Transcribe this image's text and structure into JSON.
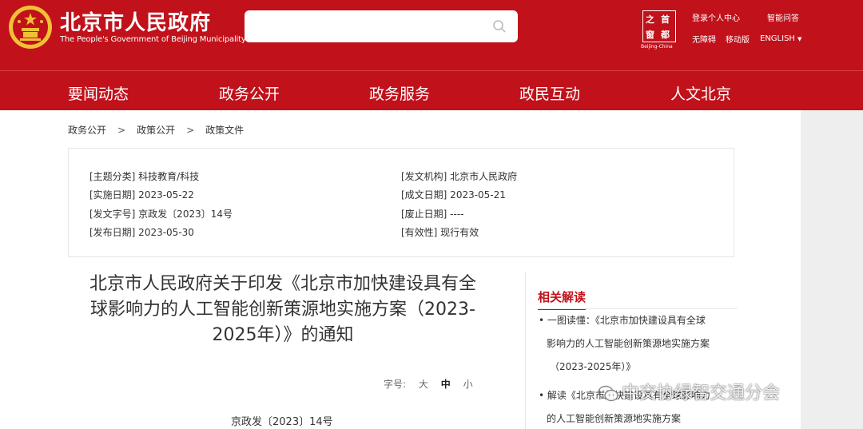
{
  "header": {
    "title": "北京市人民政府",
    "subtitle": "The People's Government of Beijing Municipality",
    "search": {
      "placeholder": ""
    },
    "capital_logo": {
      "chars": [
        "之",
        "首",
        "窗",
        "都"
      ],
      "caption": "Beijing-China"
    },
    "links": {
      "login": "登录个人中心",
      "qa": "智能问答",
      "accessible": "无障碍",
      "mobile": "移动版",
      "english": "ENGLISH"
    }
  },
  "nav": [
    "要闻动态",
    "政务公开",
    "政务服务",
    "政民互动",
    "人文北京"
  ],
  "breadcrumb": [
    "政务公开",
    "政策公开",
    "政策文件"
  ],
  "meta": {
    "topic": "[主题分类] 科技教育/科技",
    "issuer": "[发文机构] 北京市人民政府",
    "effective": "[实施日期] 2023-05-22",
    "written": "[成文日期] 2023-05-21",
    "doc_no": "[发文字号] 京政发〔2023〕14号",
    "repeal": "[废止日期] ----",
    "published": "[发布日期] 2023-05-30",
    "validity": "[有效性] 现行有效"
  },
  "article": {
    "title_lines": [
      "北京市人民政府关于印发《北京市加快建设具有全",
      "球影响力的人工智能创新策源地实施方案（2023-",
      "2025年）》的通知"
    ],
    "font_size_label": "字号:",
    "font_sizes": [
      "大",
      "中",
      "小"
    ],
    "doc_number": "京政发〔2023〕14号"
  },
  "related": {
    "heading": "相关解读",
    "items": [
      {
        "lines": [
          "• 一图读懂：《北京市加快建设具有全球",
          "影响力的人工智能创新策源地实施方案",
          "（2023-2025年）》"
        ]
      },
      {
        "lines": [
          "• 解读《北京市加快建设具有全球影响力",
          "的人工智能创新策源地实施方案"
        ]
      }
    ]
  },
  "watermark": "中交协绿智交通分会",
  "colors": {
    "brand_red": "#c1111b",
    "panel_grey": "#eeeeee"
  }
}
